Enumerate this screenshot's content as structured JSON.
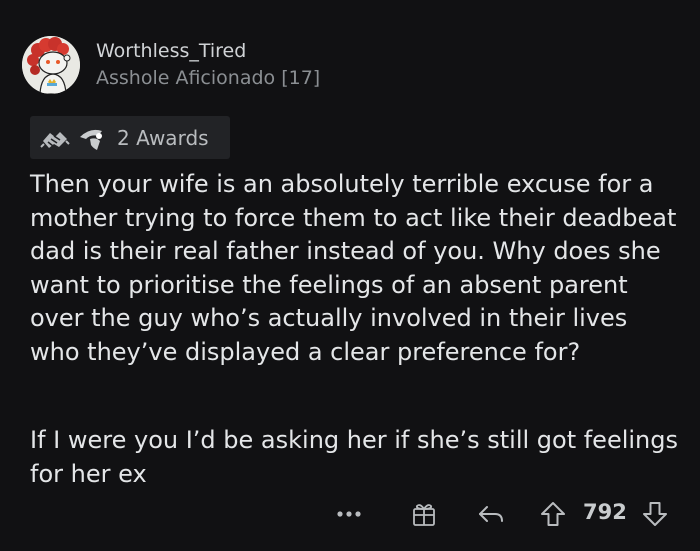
{
  "comment": {
    "author": "Worthless_Tired",
    "flair": "Asshole Aficionado [17]",
    "awards": {
      "count_label": "2 Awards",
      "icons": [
        "handshake-award-icon",
        "wholesome-award-icon"
      ]
    },
    "paragraphs": [
      "Then your wife is an absolutely terrible excuse for a mother trying to force them to act like their deadbeat dad is their real father instead of you. Why does she want to prioritise the feelings of an absent parent over the guy who’s actually involved in their lives who they’ve displayed a clear preference for?",
      "If I were you I’d be asking her if she’s still got feelings for her ex"
    ]
  },
  "actions": {
    "more": "more-options-icon",
    "award": "give-award-icon",
    "reply": "reply-icon",
    "upvote": "upvote-icon",
    "score": "792",
    "downvote": "downvote-icon"
  },
  "colors": {
    "background": "#111113",
    "text": "#e4e6e8",
    "muted": "#8b8f93",
    "award_pill": "#222326"
  }
}
